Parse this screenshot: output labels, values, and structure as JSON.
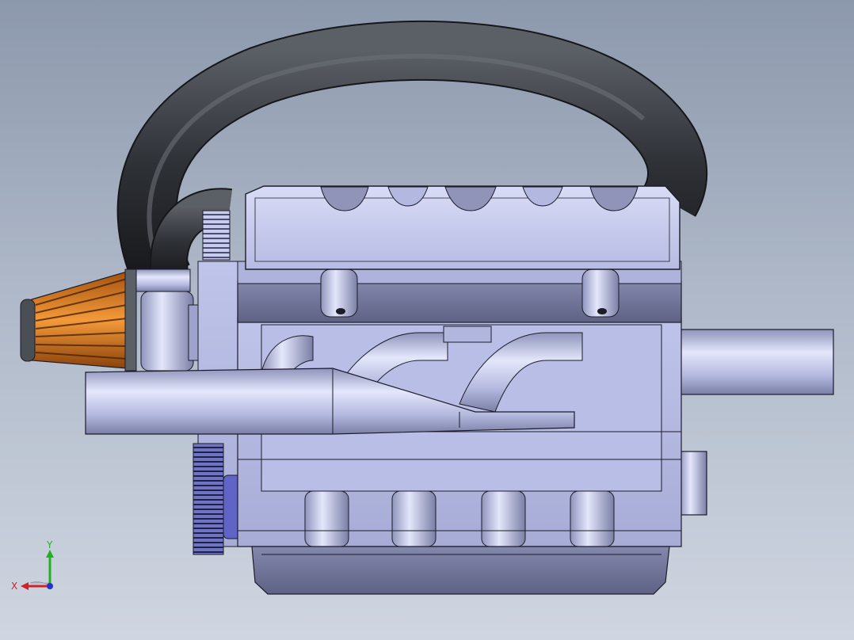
{
  "viewport": {
    "background_top": "#8c98ac",
    "background_bottom": "#cfd6e1"
  },
  "model": {
    "parts": [
      "intake-hose",
      "air-filter",
      "valve-cover",
      "cylinder-head",
      "exhaust-manifold",
      "exhaust-pipe",
      "engine-block",
      "oil-pan",
      "timing-pulley",
      "flywheel"
    ],
    "colors": {
      "hose": "#3a3d42",
      "filter": "#d97a20",
      "metal": "#c4c9ec",
      "metal_dark": "#8f94b8",
      "edge": "#1c1c28"
    }
  },
  "triad": {
    "x_label": "X",
    "y_label": "Y",
    "x_color": "#d0222a",
    "y_color": "#23b023",
    "z_color": "#2233cc"
  }
}
